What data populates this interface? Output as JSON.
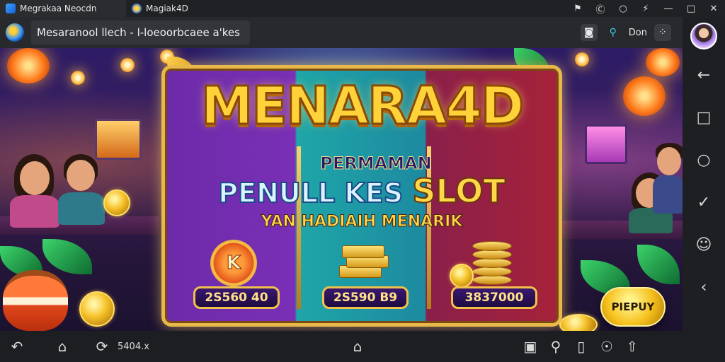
{
  "tabs": [
    {
      "label": "Megrakaa Neocdn",
      "active": true
    },
    {
      "label": "Magiak4D",
      "active": false
    }
  ],
  "window_controls": [
    "⚑",
    "Ⓒ",
    "○",
    "⚡",
    "—",
    "□",
    "✕"
  ],
  "address": {
    "url_text": "Mesaranool llech - l-loeoorbcaee a'kes",
    "don_label": "Don"
  },
  "banner": {
    "title": "MENARA4D",
    "line1": "PERMAMAN",
    "line2_a": "PENULL KES",
    "line2_b": "SLOT",
    "line3": "YAN HADIAIH MENARIK",
    "k_badge": "K",
    "prizes": [
      "2S560 40",
      "2S590 B9",
      "3837000"
    ],
    "play_label": "PIEPUY"
  },
  "bottom": {
    "counter_text": "5404.x"
  },
  "icons": {
    "tab1": "app-icon",
    "tab2": "coin-icon",
    "camera": "camera-icon",
    "search": "search-icon",
    "grid": "grid-icon",
    "back": "back-arrow-icon",
    "square": "recent-apps-icon",
    "circle": "home-circle-icon",
    "check": "check-icon",
    "emoji": "emoji-icon",
    "collapse": "chevron-left-icon"
  },
  "colors": {
    "title_gold": "#ffd23a",
    "frame_gold": "#e8b94a",
    "panel_purple": "#7a2fb6",
    "panel_teal": "#1fa6a8",
    "panel_red": "#a6223a"
  }
}
